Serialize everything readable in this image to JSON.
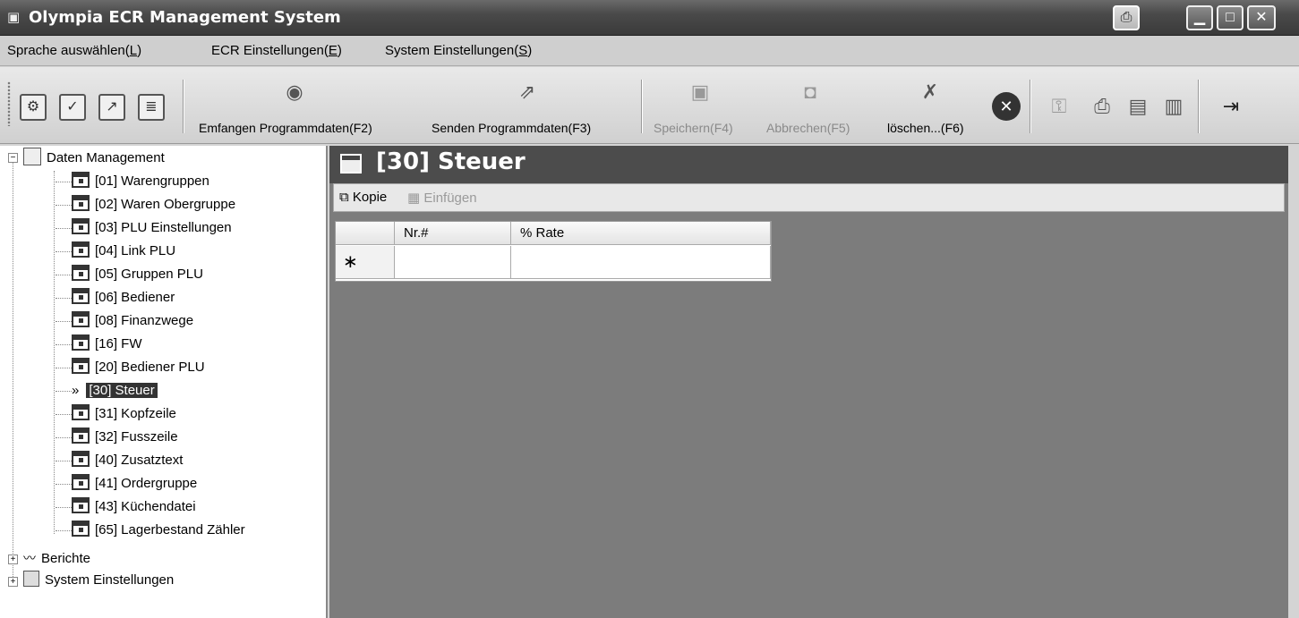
{
  "window": {
    "title": "Olympia ECR Management System",
    "app_icon": "cash-register-icon",
    "controls": [
      "print-icon",
      "minimize-icon",
      "maximize-icon",
      "close-icon"
    ]
  },
  "menu": {
    "items": [
      {
        "label": "Sprache auswählen(",
        "key": "L",
        "end": ")"
      },
      {
        "label": "ECR Einstellungen(",
        "key": "E",
        "end": ")"
      },
      {
        "label": "System Einstellungen(",
        "key": "S",
        "end": ")"
      }
    ]
  },
  "toolbar": {
    "receive_label": "Emfangen Programmdaten(F2)",
    "send_label": "Senden Programmdaten(F3)",
    "save_label": "Speichern(F4)",
    "cancel_label": "Abbrechen(F5)",
    "delete_label": "löschen...(F6)"
  },
  "tree": {
    "root_label": "Daten Management",
    "items": [
      "[01] Warengruppen",
      "[02] Waren Obergruppe",
      "[03] PLU Einstellungen",
      "[04] Link PLU",
      "[05] Gruppen PLU",
      "[06] Bediener",
      "[08] Finanzwege",
      "[16] FW",
      "[20] Bediener PLU",
      "[30] Steuer",
      "[31] Kopfzeile",
      "[32] Fusszeile",
      "[40] Zusatztext",
      "[41] Ordergruppe",
      "[43] Küchendatei",
      "[65] Lagerbestand Zähler"
    ],
    "selected_marker": "»",
    "reports_label": "Berichte",
    "system_label": "System Einstellungen"
  },
  "content": {
    "title": "[30] Steuer",
    "copy_label": "Kopie",
    "paste_label": "Einfügen",
    "columns": [
      "Nr.#",
      "% Rate"
    ],
    "new_row_marker": "∗"
  }
}
